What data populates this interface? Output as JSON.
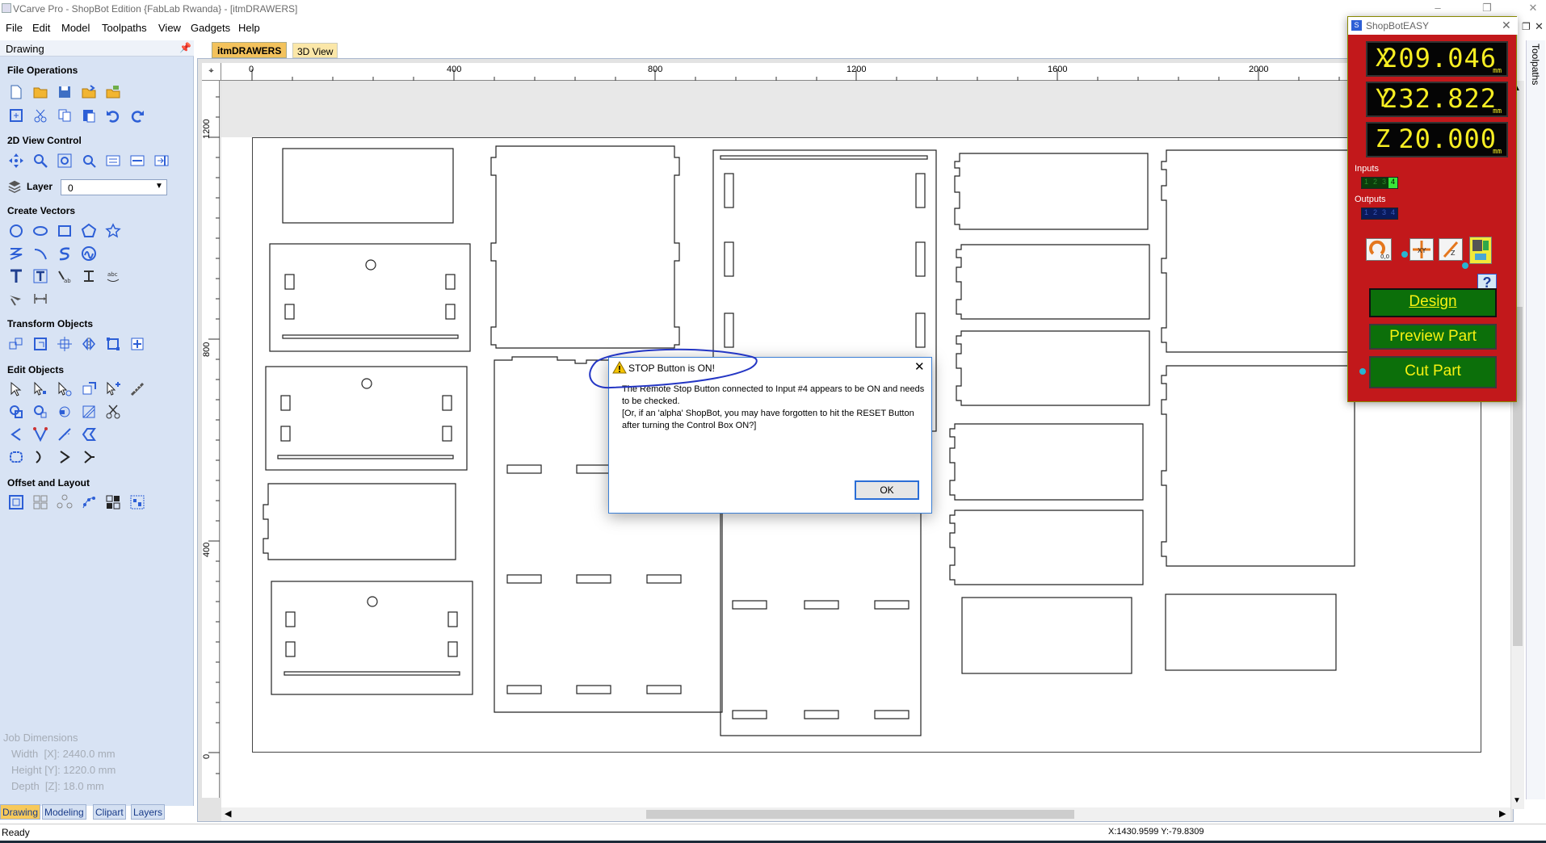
{
  "window": {
    "title": "VCarve Pro - ShopBot Edition {FabLab Rwanda} - [itmDRAWERS]"
  },
  "menu": [
    "File",
    "Edit",
    "Model",
    "Toolpaths",
    "View",
    "Gadgets",
    "Help"
  ],
  "panel": {
    "header": "Drawing",
    "sections": {
      "file_operations": "File Operations",
      "view_control": "2D View Control",
      "create_vectors": "Create Vectors",
      "transform_objects": "Transform Objects",
      "edit_objects": "Edit Objects",
      "offset_layout": "Offset and Layout"
    },
    "layer": {
      "label": "Layer",
      "value": "0"
    },
    "job_dimensions": {
      "title": "Job Dimensions",
      "width": "Width  [X]: 2440.0 mm",
      "height": "Height [Y]: 1220.0 mm",
      "depth": "Depth  [Z]: 18.0 mm"
    },
    "bottom_tabs": [
      "Drawing",
      "Modeling",
      "Clipart",
      "Layers"
    ]
  },
  "doc_tabs": [
    "itmDRAWERS",
    "3D View"
  ],
  "ruler_h": [
    "0",
    "400",
    "800",
    "1200",
    "1600",
    "2000"
  ],
  "ruler_v": [
    "1200",
    "800",
    "400",
    "0"
  ],
  "right_tab": "Toolpaths",
  "status": {
    "left": "Ready",
    "coords": "X:1430.9599 Y:-79.8309"
  },
  "dialog": {
    "title": "STOP Button is ON!",
    "line1": "The Remote Stop Button connected to Input #4 appears to be ON and needs to be checked.",
    "line2": "[Or, if an 'alpha' ShopBot, you may have forgotten to hit the RESET Button after turning the Control Box ON?]",
    "ok": "OK"
  },
  "shopbot_easy": {
    "title": "ShopBotEASY",
    "x": {
      "axis": "X",
      "value": "209.046",
      "unit": "mm"
    },
    "y": {
      "axis": "Y",
      "value": "232.822",
      "unit": "mm"
    },
    "z": {
      "axis": "Z",
      "value": "20.000",
      "unit": "mm"
    },
    "inputs_label": "Inputs",
    "inputs": [
      "1",
      "2",
      "3",
      "4"
    ],
    "outputs_label": "Outputs",
    "outputs": [
      "1",
      "2",
      "3",
      "4"
    ],
    "help": "?",
    "buttons": {
      "design": "Design",
      "preview": "Preview Part",
      "cut": "Cut Part"
    }
  },
  "colors": {
    "accent_blue": "#2d5fd6",
    "sbe_red": "#c2181b",
    "button_green": "#0c6f0a",
    "dro_yellow": "#f7ee22"
  }
}
